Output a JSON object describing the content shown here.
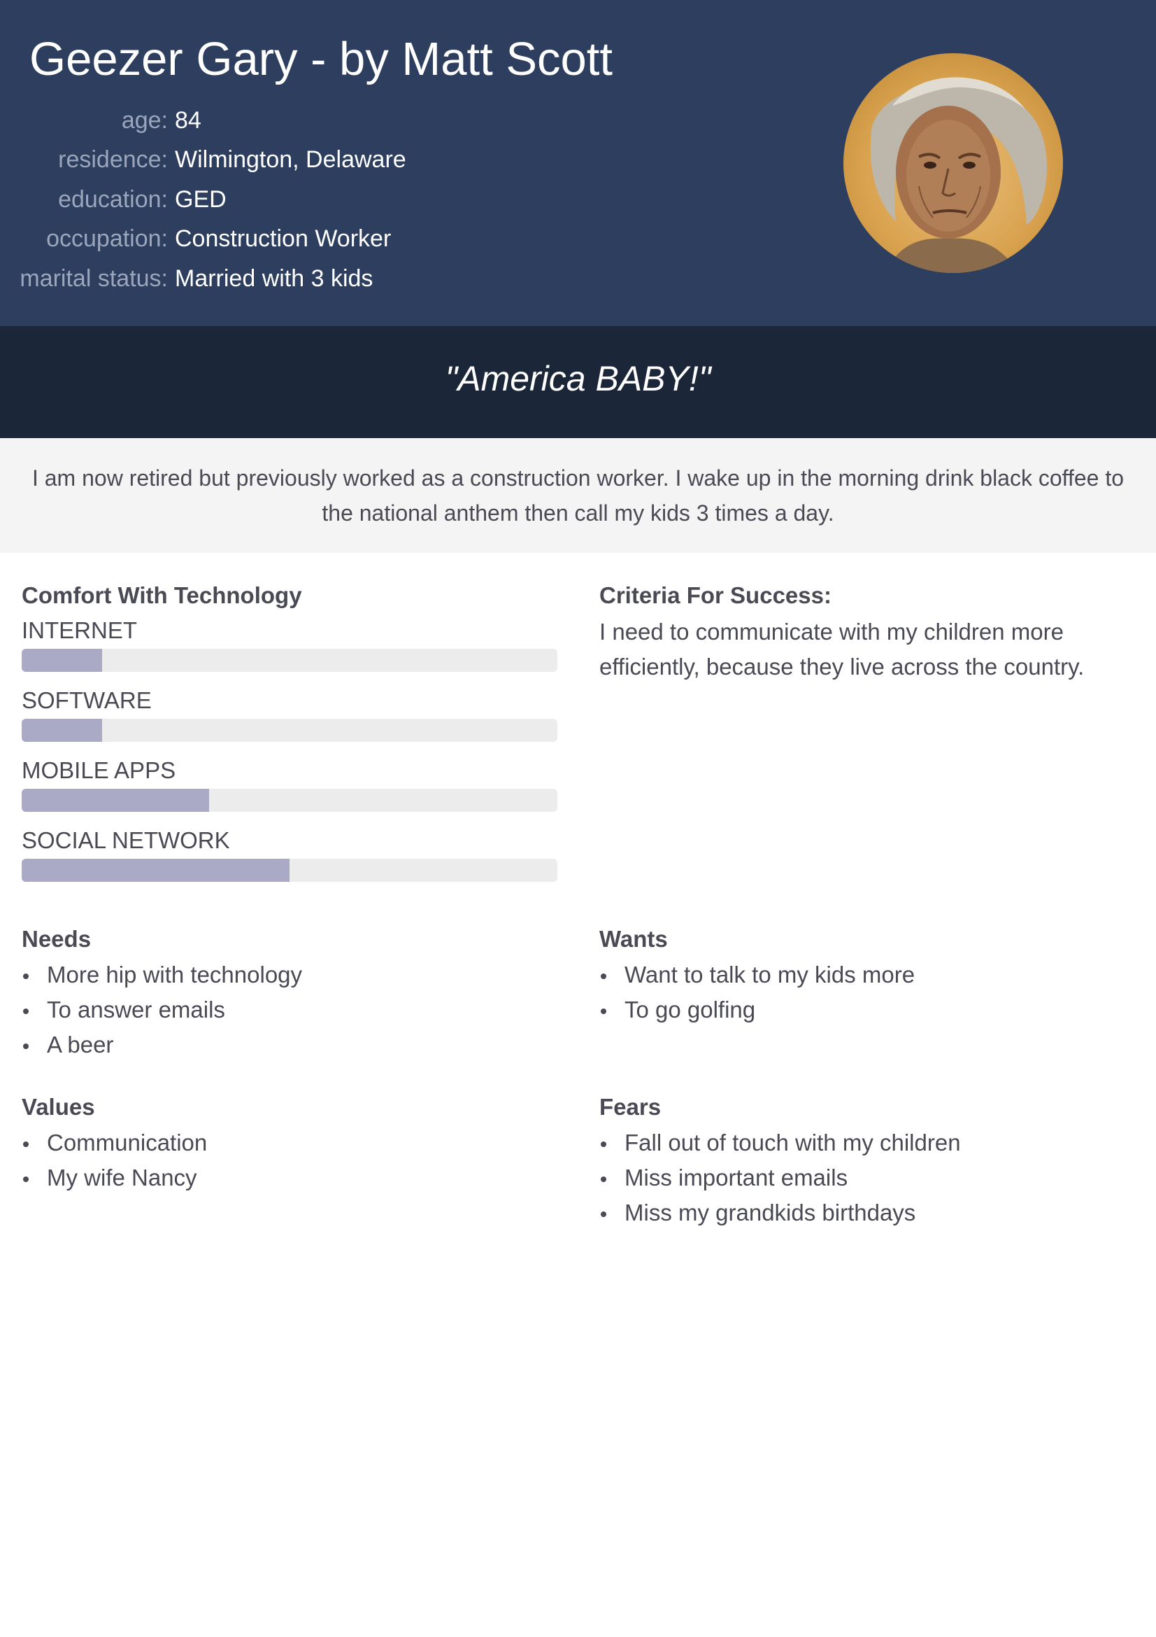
{
  "header": {
    "title": "Geezer Gary - by Matt Scott",
    "fields": [
      {
        "label": "age:",
        "value": "84"
      },
      {
        "label": "residence:",
        "value": "Wilmington, Delaware"
      },
      {
        "label": "education:",
        "value": "GED"
      },
      {
        "label": "occupation:",
        "value": "Construction Worker"
      },
      {
        "label": "marital status:",
        "value": "Married with 3 kids"
      }
    ],
    "avatar_icon": "elderly-person-portrait-photo"
  },
  "quote": "\"America BABY!\"",
  "bio": "I am now retired but previously worked as a construction worker. I wake up in the morning drink black coffee to the national anthem then call my kids 3 times a day.",
  "comfort": {
    "title": "Comfort With Technology",
    "items": [
      {
        "label": "INTERNET",
        "level": 0.15
      },
      {
        "label": "SOFTWARE",
        "level": 0.15
      },
      {
        "label": "MOBILE APPS",
        "level": 0.35
      },
      {
        "label": "SOCIAL NETWORK",
        "level": 0.5
      }
    ]
  },
  "success": {
    "title": "Criteria For Success:",
    "text": "I need to communicate with my children more efficiently, because they live across the country."
  },
  "needs": {
    "title": "Needs",
    "items": [
      "More hip with technology",
      "To answer emails",
      "A beer"
    ]
  },
  "wants": {
    "title": "Wants",
    "items": [
      "Want to talk to my kids more",
      "To go golfing"
    ]
  },
  "values": {
    "title": "Values",
    "items": [
      "Communication",
      "My wife Nancy"
    ]
  },
  "fears": {
    "title": "Fears",
    "items": [
      "Fall out of touch with my children",
      "Miss important emails",
      "Miss my grandkids birthdays"
    ]
  },
  "colors": {
    "header_bg": "#2d3e5f",
    "quote_bg": "#1c2639",
    "bar_fill": "#abaac6",
    "bar_track": "#ececec"
  }
}
